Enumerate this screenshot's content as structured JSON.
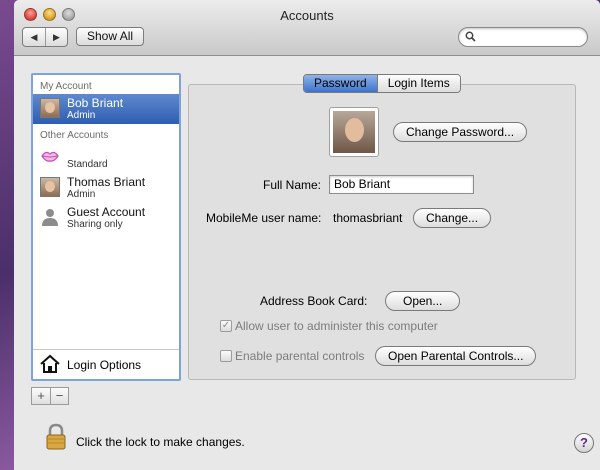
{
  "window": {
    "title": "Accounts"
  },
  "toolbar": {
    "back_icon": "chevron-left-icon",
    "forward_icon": "chevron-right-icon",
    "show_all_label": "Show All",
    "search_value": ""
  },
  "sidebar": {
    "my_account_header": "My Account",
    "other_accounts_header": "Other Accounts",
    "accounts": [
      {
        "name": "Bob Briant",
        "role": "Admin",
        "selected": true
      },
      {
        "name": "",
        "role": "Standard",
        "selected": false
      },
      {
        "name": "Thomas Briant",
        "role": "Admin",
        "selected": false
      },
      {
        "name": "Guest Account",
        "role": "Sharing only",
        "selected": false
      }
    ],
    "login_options_label": "Login Options",
    "add_label": "+",
    "remove_label": "−"
  },
  "tabs": [
    {
      "label": "Password",
      "active": true
    },
    {
      "label": "Login Items",
      "active": false
    }
  ],
  "password_pane": {
    "change_password_label": "Change Password...",
    "full_name_label": "Full Name:",
    "full_name_value": "Bob Briant",
    "mobileme_label": "MobileMe user name:",
    "mobileme_value": "thomasbriant",
    "mobileme_change_label": "Change...",
    "address_book_label": "Address Book Card:",
    "address_book_open_label": "Open...",
    "allow_admin_label": "Allow user to administer this computer",
    "allow_admin_checked": true,
    "parental_label": "Enable parental controls",
    "parental_checked": false,
    "open_parental_label": "Open Parental Controls..."
  },
  "footer": {
    "lock_text": "Click the lock to make changes.",
    "help_label": "?"
  },
  "colors": {
    "selection": "#2d5eb0",
    "tab_active": "#3d74cc",
    "focus_ring": "#7ea3d8"
  }
}
